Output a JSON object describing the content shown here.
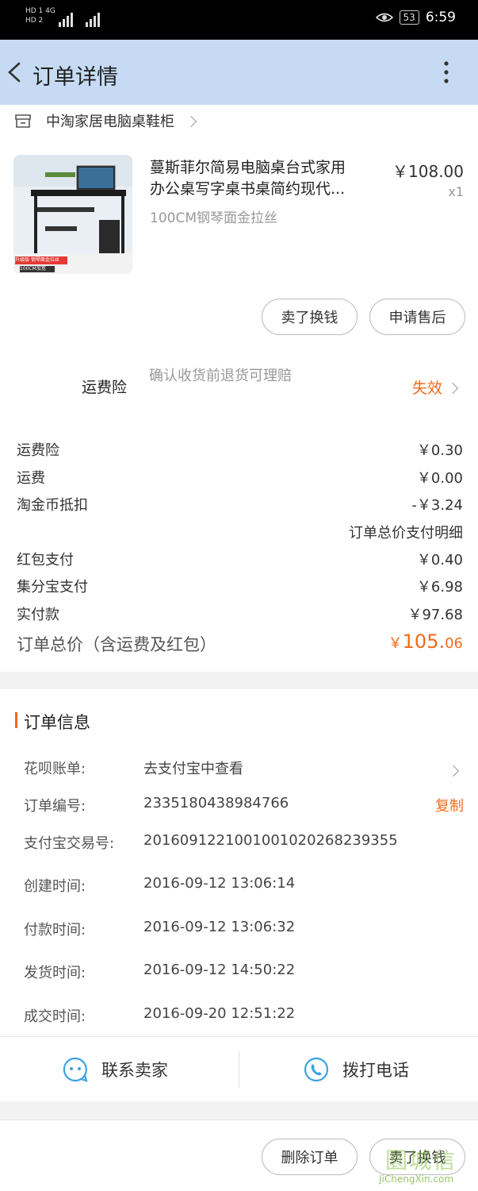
{
  "status_bar": {
    "left_line1": "HD 1  4G",
    "left_line2": "HD 2",
    "battery": "53",
    "time": "6:59"
  },
  "header": {
    "title": "订单详情"
  },
  "shop": {
    "name": "中淘家居电脑桌鞋柜"
  },
  "product": {
    "title_line1": "蔓斯菲尔简易电脑桌台式家用",
    "title_line2": "办公桌写字桌书桌简约现代...",
    "sku": "100CM钢琴面金拉丝",
    "price": "￥108.00",
    "qty": "x1",
    "thumb_tag": "升级版 钢琴面金拉丝",
    "thumb_size": "100CM加宽"
  },
  "product_actions": {
    "sell_label": "卖了换钱",
    "after_sale_label": "申请售后"
  },
  "shipping_insurance": {
    "label": "运费险",
    "desc": "确认收货前退货可理赔",
    "status": "失效"
  },
  "fees": [
    {
      "label": "运费险",
      "value": "￥0.30"
    },
    {
      "label": "运费",
      "value": "￥0.00"
    },
    {
      "label": "淘金币抵扣",
      "value": "-￥3.24"
    }
  ],
  "detail_link": "订单总价支付明细",
  "payments": [
    {
      "label": "红包支付",
      "value": "￥0.40"
    },
    {
      "label": "集分宝支付",
      "value": "￥6.98"
    },
    {
      "label": "实付款",
      "value": "￥97.68"
    }
  ],
  "total": {
    "label": "订单总价（含运费及红包）",
    "symbol": "￥",
    "integer": "105.",
    "decimal": "06"
  },
  "order_info": {
    "title": "订单信息",
    "rows": [
      {
        "label": "花呗账单:",
        "value": "去支付宝中查看"
      },
      {
        "label": "订单编号:",
        "value": "2335180438984766",
        "action": "复制"
      },
      {
        "label": "支付宝交易号:",
        "value": "2016091221001001020268239355"
      },
      {
        "label": "创建时间:",
        "value": "2016-09-12 13:06:14"
      },
      {
        "label": "付款时间:",
        "value": "2016-09-12 13:06:32"
      },
      {
        "label": "发货时间:",
        "value": "2016-09-12 14:50:22"
      },
      {
        "label": "成交时间:",
        "value": "2016-09-20 12:51:22"
      }
    ]
  },
  "contact": {
    "seller_label": "联系卖家",
    "call_label": "拨打电话"
  },
  "bottom_actions": {
    "delete_label": "删除订单",
    "sell_label": "卖了换钱"
  },
  "watermark": {
    "logo": "圜城信",
    "url": "JiChengXin.com"
  },
  "colors": {
    "accent": "#f06a1c",
    "header_bg": "#c6daf3",
    "icon_blue": "#3aa3e3"
  }
}
